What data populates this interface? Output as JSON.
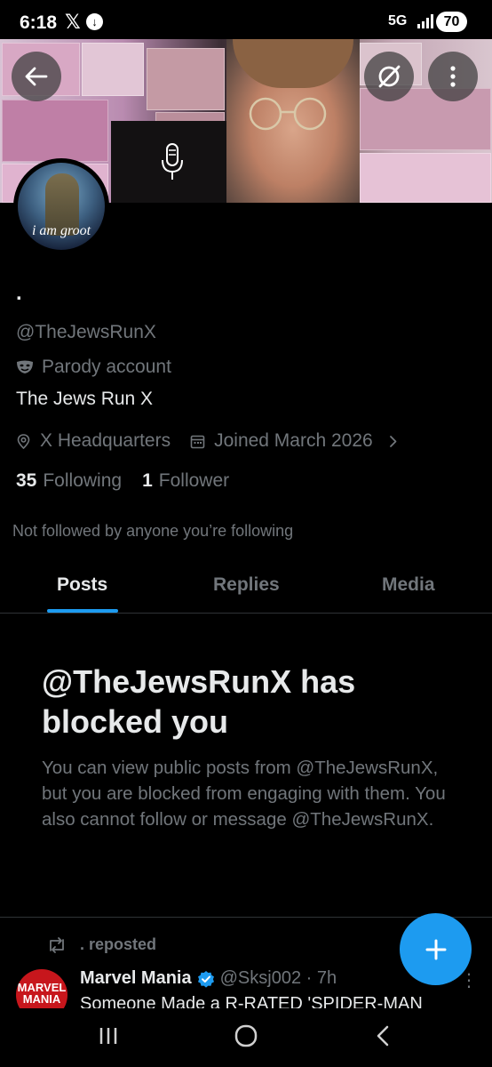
{
  "status_bar": {
    "time": "6:18",
    "x_logo": "𝕏",
    "download_icon": "download-icon",
    "network": "5G",
    "battery": "70"
  },
  "banner": {
    "back_icon": "back-arrow-icon",
    "grok_icon": "grok-icon",
    "more_icon": "more-vertical-icon"
  },
  "profile": {
    "avatar_text": "i am groot",
    "display_name": ".",
    "handle": "@TheJewsRunX",
    "parody_label": "Parody account",
    "bio": "The Jews Run X",
    "location": "X Headquarters",
    "joined": "Joined March 2026",
    "following_count": "35",
    "following_label": "Following",
    "followers_count": "1",
    "followers_label": "Follower",
    "not_followed": "Not followed by anyone you’re following"
  },
  "tabs": [
    {
      "label": "Posts",
      "active": true
    },
    {
      "label": "Replies",
      "active": false
    },
    {
      "label": "Media",
      "active": false
    }
  ],
  "blocked": {
    "title": "@TheJewsRunX has blocked you",
    "body": "You can view public posts from @TheJewsRunX, but you are blocked from engaging with them. You also cannot follow or message @TheJewsRunX."
  },
  "post": {
    "repost_label": ". reposted",
    "avatar_text": "MARVEL MANIA",
    "author_name": "Marvel Mania",
    "author_handle": "@Sksj002 · 7h",
    "text": "Someone Made a R-RATED 'SPIDER-MAN",
    "more": "⋮"
  },
  "colors": {
    "accent": "#1d9bf0",
    "secondary_text": "#71767b",
    "primary_text": "#e7e9ea",
    "divider": "#2f3336"
  }
}
